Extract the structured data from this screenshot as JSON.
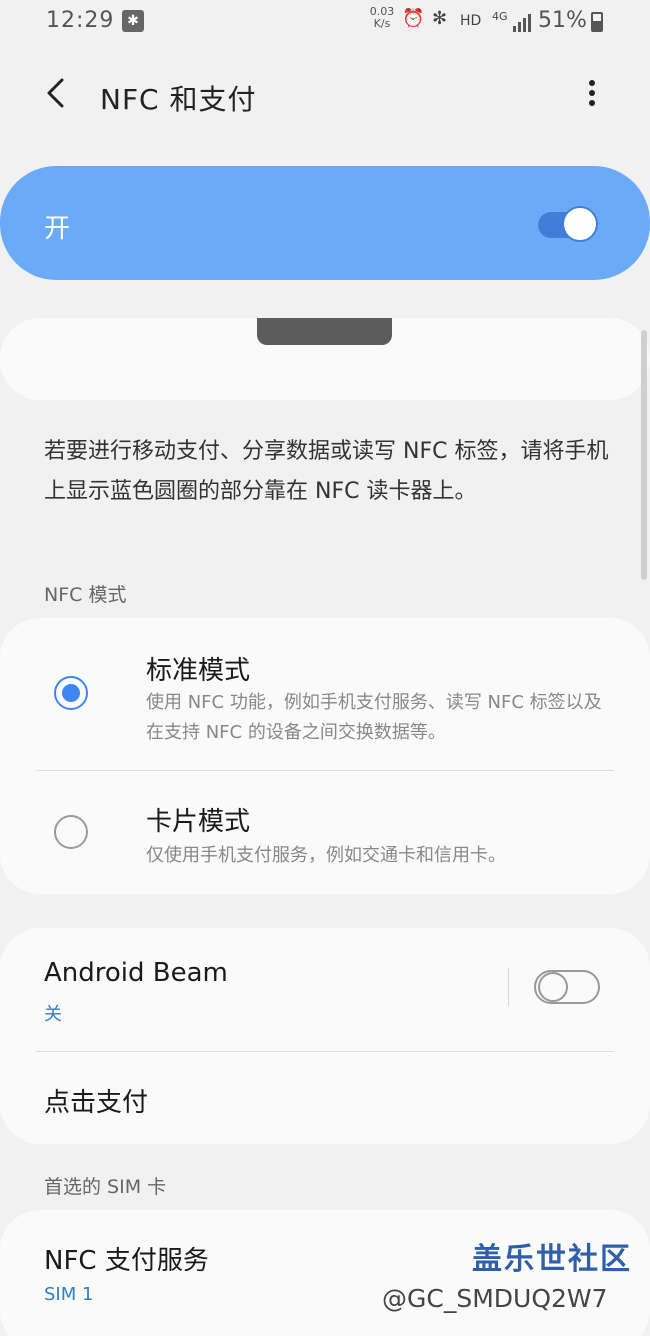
{
  "status_bar": {
    "time": "12:29",
    "bt_small": "✱",
    "net_speed_value": "0.03",
    "net_speed_unit": "K/s",
    "hd": "HD",
    "net_type": "4G",
    "battery": "51%"
  },
  "header": {
    "title": "NFC 和支付"
  },
  "master_switch": {
    "label": "开",
    "state": "on",
    "accent": "#6aaaf7"
  },
  "description": "若要进行移动支付、分享数据或读写 NFC 标签，请将手机上显示蓝色圆圈的部分靠在 NFC 读卡器上。",
  "nfc_mode": {
    "section_label": "NFC 模式",
    "options": [
      {
        "title": "标准模式",
        "subtitle": "使用 NFC 功能，例如手机支付服务、读写 NFC 标签以及在支持 NFC 的设备之间交换数据等。",
        "selected": true
      },
      {
        "title": "卡片模式",
        "subtitle": "仅使用手机支付服务，例如交通卡和信用卡。",
        "selected": false
      }
    ]
  },
  "android_beam": {
    "title": "Android Beam",
    "status": "关",
    "state": "off"
  },
  "tap_pay": {
    "title": "点击支付"
  },
  "sim": {
    "section_label": "首选的 SIM 卡",
    "item_title": "NFC 支付服务",
    "item_sub": "SIM 1"
  },
  "watermark": {
    "line1": "盖乐世社区",
    "line2": "@GC_SMDUQ2W7"
  },
  "colors": {
    "background": "#f1f1f1",
    "card": "#fafafa",
    "primary_blue": "#3f87ef",
    "link_blue": "#2a7fd0"
  }
}
